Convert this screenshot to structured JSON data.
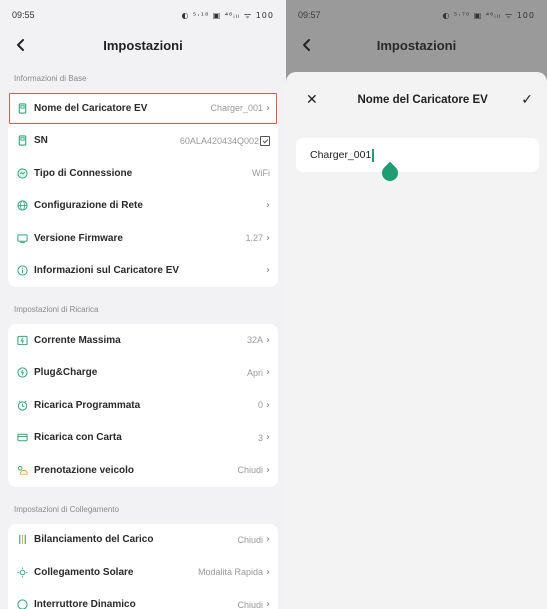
{
  "left": {
    "status": {
      "time": "09:55",
      "icons": "◐ ⁵·¹⁸ ▣ ⁴⁶ᵢₗₗ ᯤ 100"
    },
    "title": "Impostazioni",
    "sections": [
      {
        "label": "Informazioni di Base",
        "rows": [
          {
            "label": "Nome del Caricatore EV",
            "value": "Charger_001",
            "icon": "charger-icon"
          },
          {
            "label": "SN",
            "value": "60ALA420434Q002",
            "icon": "charger-icon"
          },
          {
            "label": "Tipo di Connessione",
            "value": "WiFi",
            "icon": "connection-icon"
          },
          {
            "label": "Configurazione di Rete",
            "value": "",
            "icon": "globe-icon"
          },
          {
            "label": "Versione Firmware",
            "value": "1.27",
            "icon": "monitor-icon"
          },
          {
            "label": "Informazioni sul Caricatore EV",
            "value": "",
            "icon": "info-icon"
          }
        ]
      },
      {
        "label": "Impostazioni di Ricarica",
        "rows": [
          {
            "label": "Corrente Massima",
            "value": "32A",
            "icon": "current-icon"
          },
          {
            "label": "Plug&Charge",
            "value": "Apri",
            "icon": "plug-icon"
          },
          {
            "label": "Ricarica Programmata",
            "value": "0",
            "icon": "clock-icon"
          },
          {
            "label": "Ricarica con Carta",
            "value": "3",
            "icon": "card-icon"
          },
          {
            "label": "Prenotazione veicolo",
            "value": "Chiudi",
            "icon": "car-icon"
          }
        ]
      },
      {
        "label": "Impostazioni di Collegamento",
        "rows": [
          {
            "label": "Bilanciamento del Carico",
            "value": "Chiudi",
            "icon": "balance-icon"
          },
          {
            "label": "Collegamento Solare",
            "value": "Modalità Rapida",
            "icon": "solar-icon"
          },
          {
            "label": "Interruttore Dinamico",
            "value": "Chiudi",
            "icon": "switch-icon"
          }
        ]
      }
    ]
  },
  "right": {
    "status": {
      "time": "09:57",
      "icons": "◐ ⁵·⁷⁰ ▣ ⁴⁶ᵢₗₗ ᯤ 100"
    },
    "title": "Impostazioni",
    "sheet": {
      "title": "Nome del Caricatore EV",
      "close_glyph": "✕",
      "confirm_glyph": "✓",
      "input_value": "Charger_001"
    }
  },
  "colors": {
    "accent": "#1e9e70",
    "highlight_border": "#e05a4a"
  }
}
